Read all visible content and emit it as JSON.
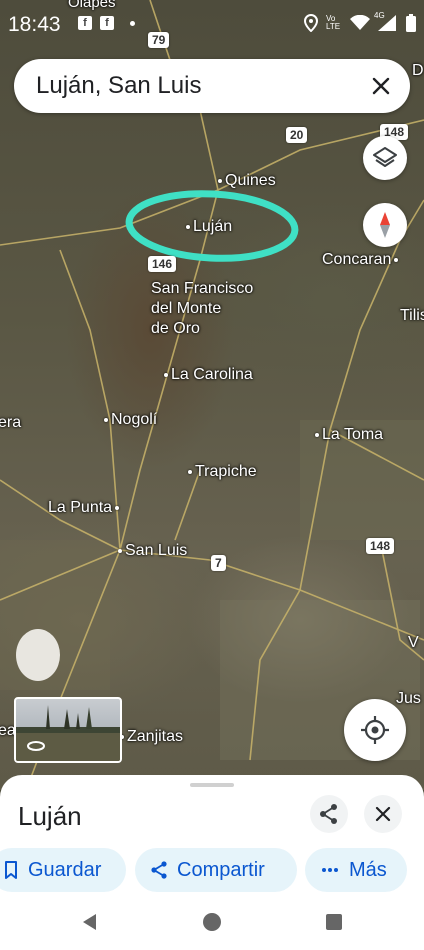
{
  "status": {
    "time": "18:43",
    "fb_glyph": "f",
    "network_label": "Vo LTE",
    "signal_label": "4G"
  },
  "search": {
    "query": "Luján, San Luis"
  },
  "map": {
    "cities": {
      "lujan": "Luján",
      "quines": "Quines",
      "concaran": "Concaran",
      "san_francisco": "San Francisco",
      "san_francisco_2": "del Monte",
      "san_francisco_3": "de Oro",
      "la_carolina": "La Carolina",
      "nogoli": "Nogolí",
      "la_toma": "La Toma",
      "trapiche": "Trapiche",
      "la_punta": "La Punta",
      "san_luis": "San Luis",
      "zanjitas": "Zanjitas",
      "tilis": "Tilis",
      "era": "era",
      "olapes": "Olapes",
      "right_d": "D",
      "right_v": "V",
      "right_jus": "Jus",
      "left_ea": "ea"
    },
    "routes": {
      "r79": "79",
      "r20": "20",
      "r148a": "148",
      "r146": "146",
      "r7": "7",
      "r148b": "148"
    },
    "highlight_color": "#3fe0c5"
  },
  "sheet": {
    "title": "Luján",
    "actions": {
      "save": "Guardar",
      "share": "Compartir",
      "more": "Más"
    }
  },
  "icons": {
    "close": "close-icon",
    "layers": "layers-icon",
    "compass": "compass-icon",
    "my_location": "my-location-icon",
    "share": "share-icon",
    "bookmark": "bookmark-icon",
    "more": "more-icon",
    "street_view": "street-view-icon"
  }
}
